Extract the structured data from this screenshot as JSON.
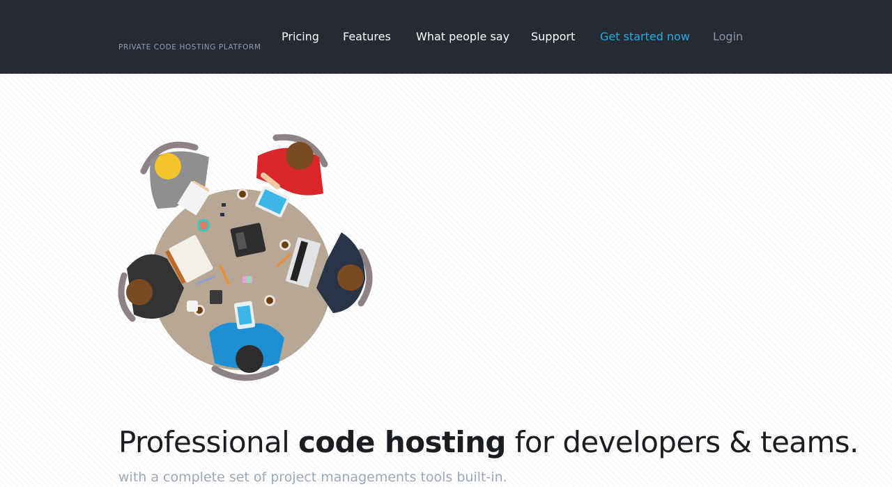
{
  "header": {
    "tagline": "PRIVATE CODE HOSTING PLATFORM",
    "nav": [
      {
        "label": "Pricing"
      },
      {
        "label": "Features"
      },
      {
        "label": "What people say"
      },
      {
        "label": "Support"
      },
      {
        "label": "Get started now"
      },
      {
        "label": "Login"
      }
    ]
  },
  "hero": {
    "headline_part1": "Professional ",
    "headline_strong": "code hosting",
    "headline_part2": " for developers & teams.",
    "subheadline": "with a complete set of project managements tools built-in."
  },
  "colors": {
    "header_bg": "#252a33",
    "accent": "#29abe2",
    "table": "#b7a794"
  }
}
